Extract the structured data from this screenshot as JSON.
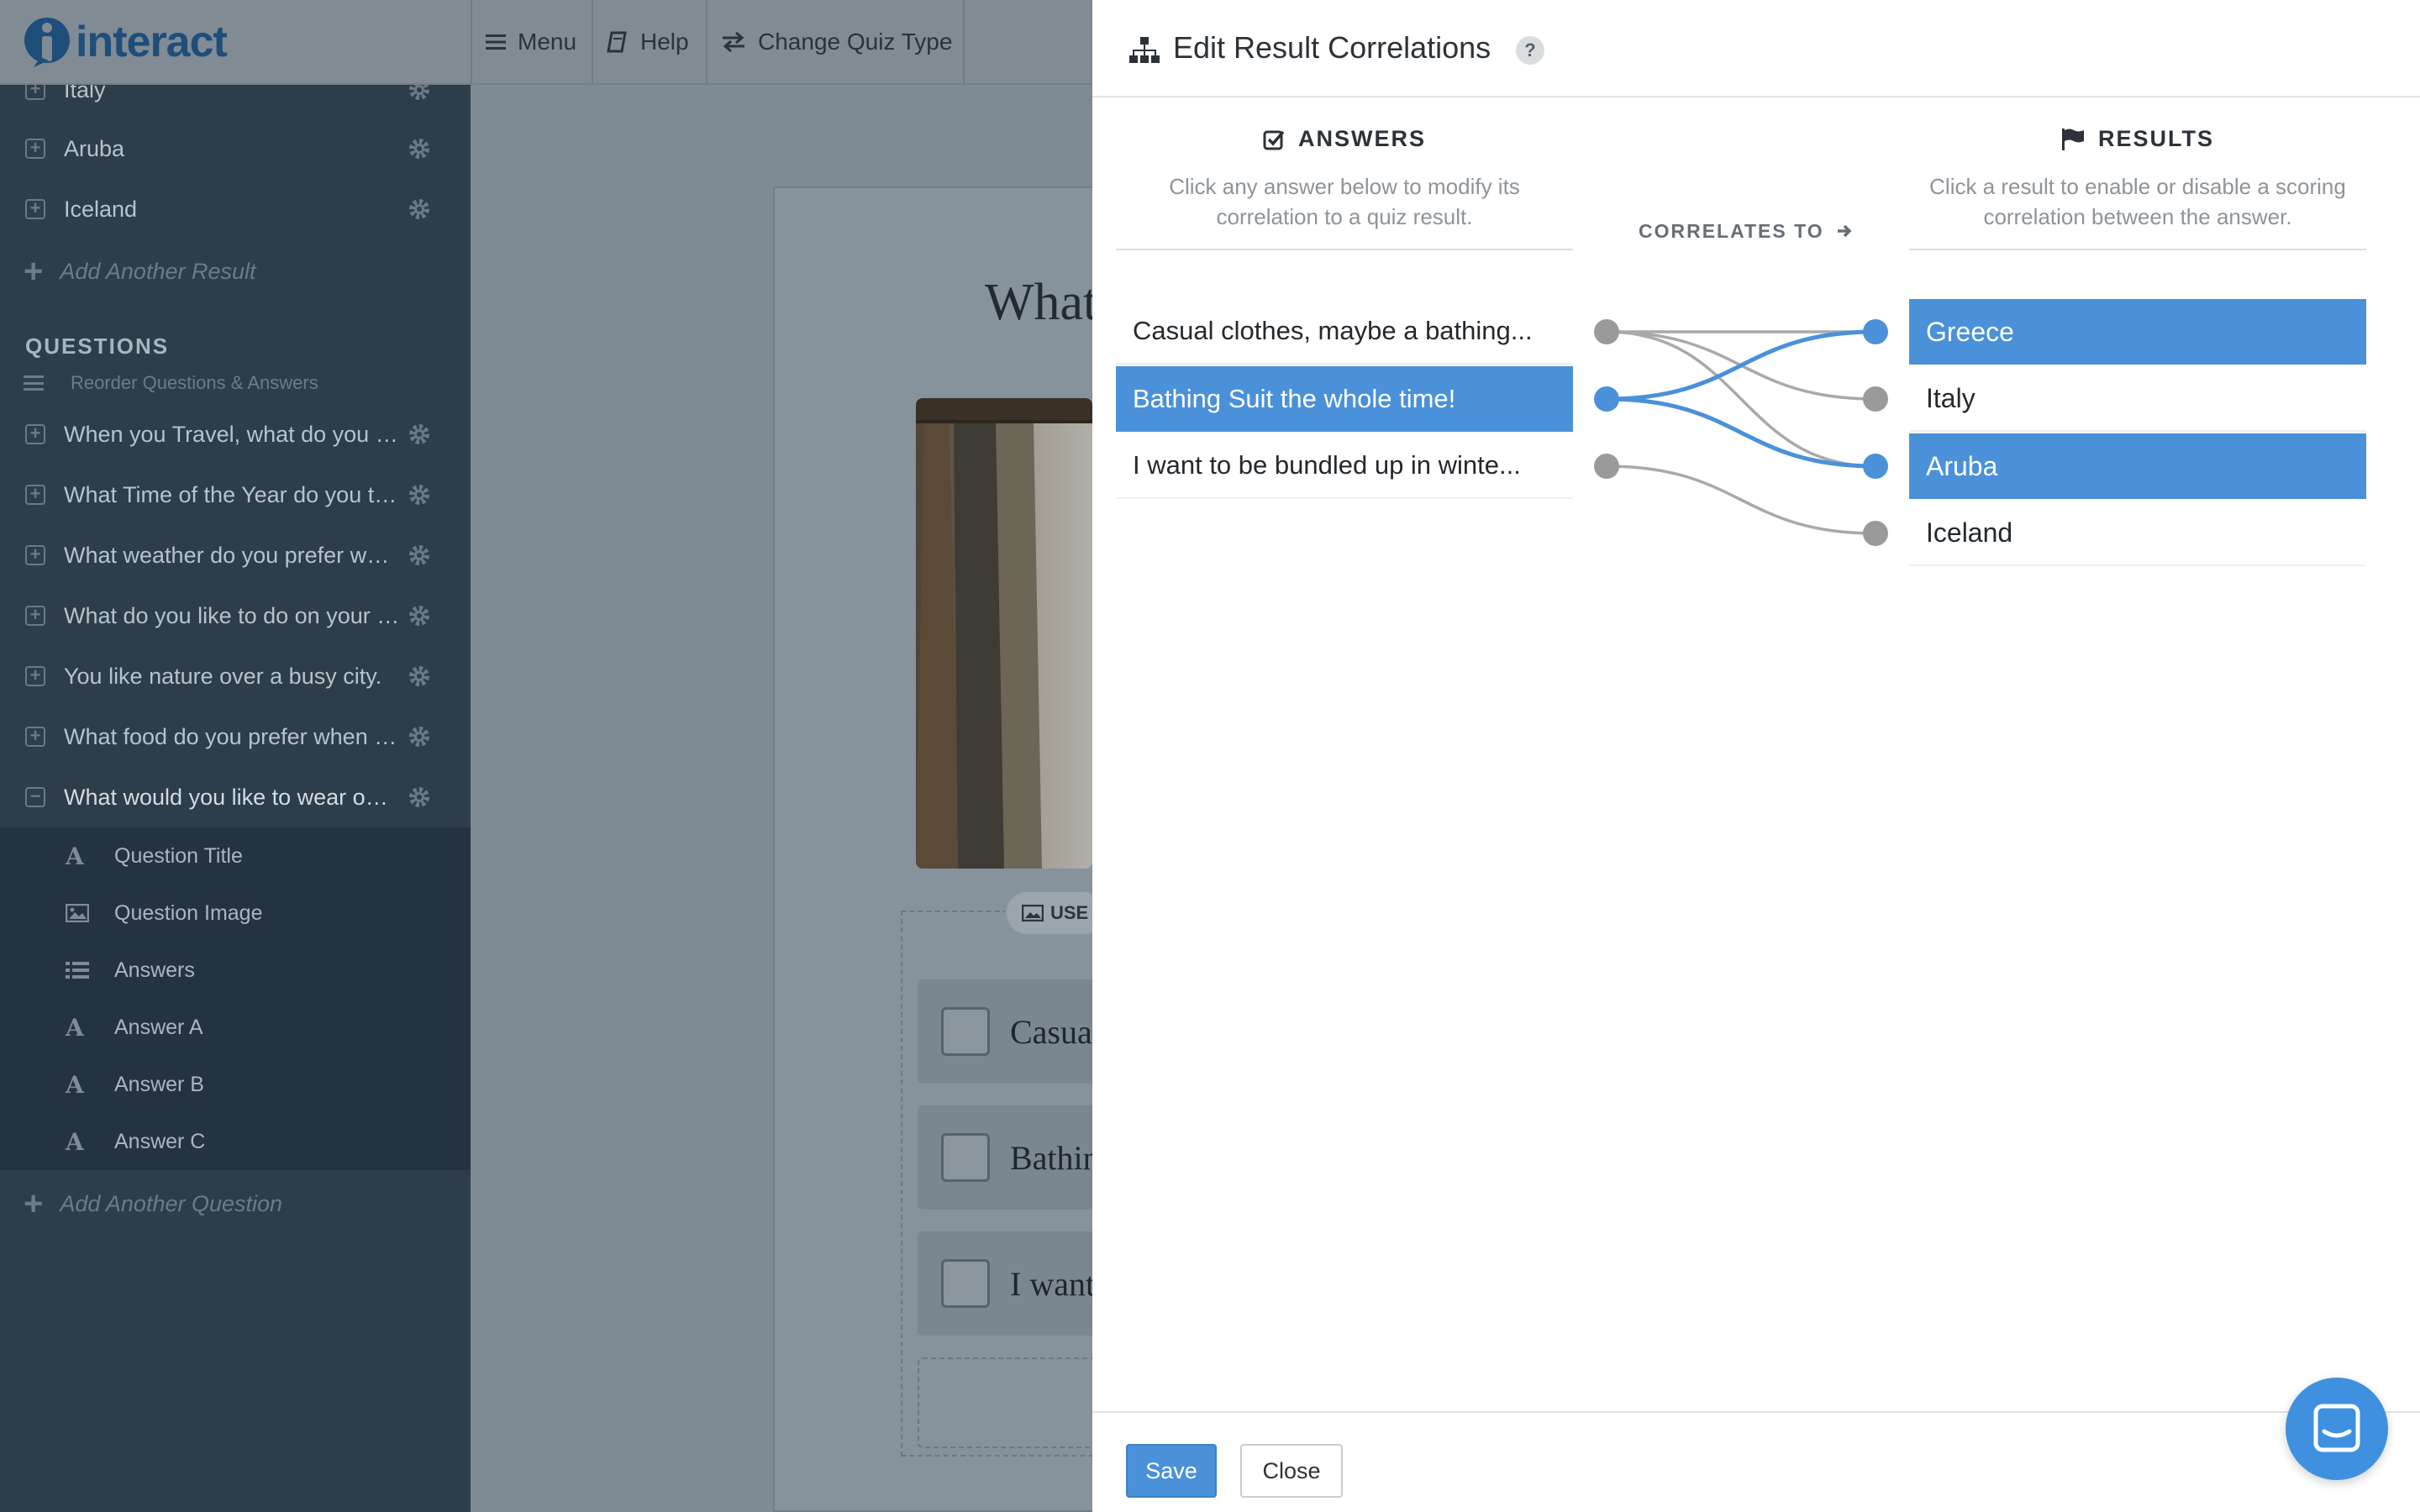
{
  "brand": {
    "name": "interact"
  },
  "topbar": {
    "menu_label": "Menu",
    "help_label": "Help",
    "change_quiz_label": "Change Quiz Type"
  },
  "sidebar": {
    "results": [
      {
        "label": "Italy"
      },
      {
        "label": "Aruba"
      },
      {
        "label": "Iceland"
      }
    ],
    "add_result_label": "Add Another Result",
    "questions_heading": "QUESTIONS",
    "reorder_label": "Reorder Questions & Answers",
    "questions": [
      {
        "label": "When you Travel, what do you pack?"
      },
      {
        "label": "What Time of the Year do you travel?"
      },
      {
        "label": "What weather do you prefer when you travel?"
      },
      {
        "label": "What do you like to do on your vacation?"
      },
      {
        "label": "You like nature over a busy city."
      },
      {
        "label": "What food do you prefer when you travel?"
      },
      {
        "label": "What would you like to wear on vacation?"
      }
    ],
    "sub_items": [
      {
        "icon": "text-icon",
        "label": "Question Title"
      },
      {
        "icon": "image-icon",
        "label": "Question Image"
      },
      {
        "icon": "list-icon",
        "label": "Answers"
      },
      {
        "icon": "text-icon",
        "label": "Answer A"
      },
      {
        "icon": "text-icon",
        "label": "Answer B"
      },
      {
        "icon": "text-icon",
        "label": "Answer C"
      }
    ],
    "add_question_label": "Add Another Question"
  },
  "canvas": {
    "question_title": "What",
    "use_image_label": "USE",
    "answers": [
      "Casual",
      "Bathin",
      "I want"
    ]
  },
  "modal": {
    "title": "Edit Result Correlations",
    "help": "?",
    "answers_heading": "ANSWERS",
    "answers_desc": "Click any answer below to modify its correlation to a quiz result.",
    "results_heading": "RESULTS",
    "results_desc": "Click a result to enable or disable a scoring correlation between the answer.",
    "correlates_label": "CORRELATES TO",
    "answers": [
      {
        "label": "Casual clothes, maybe a bathing...",
        "selected": false
      },
      {
        "label": "Bathing Suit the whole time!",
        "selected": true
      },
      {
        "label": "I want to be bundled up in winte...",
        "selected": false
      }
    ],
    "results": [
      {
        "label": "Greece",
        "selected": true
      },
      {
        "label": "Italy",
        "selected": false
      },
      {
        "label": "Aruba",
        "selected": true
      },
      {
        "label": "Iceland",
        "selected": false
      }
    ],
    "correlations": [
      {
        "answer": 0,
        "results": [
          0,
          1,
          2
        ]
      },
      {
        "answer": 1,
        "results": [
          0,
          2
        ]
      },
      {
        "answer": 2,
        "results": [
          3
        ]
      }
    ],
    "save_label": "Save",
    "close_label": "Close"
  },
  "colors": {
    "accent": "#4a91d9",
    "sidebar": "#2d3d4a",
    "node_inactive": "#9a9a9a"
  }
}
